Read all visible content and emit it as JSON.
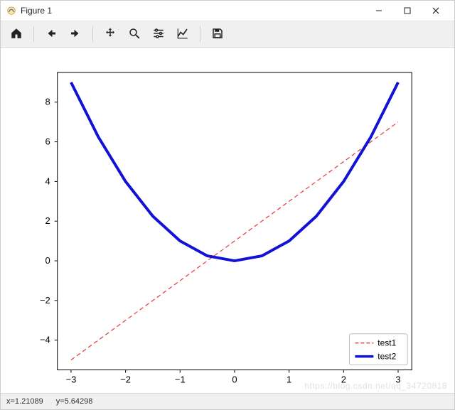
{
  "window": {
    "title": "Figure 1",
    "controls": {
      "minimize": "Minimize",
      "maximize": "Maximize",
      "close": "Close"
    }
  },
  "toolbar": {
    "home": "Home",
    "back": "Back",
    "forward": "Forward",
    "pan": "Pan",
    "zoom": "Zoom",
    "subplots": "Configure subplots",
    "axes": "Edit axis",
    "save": "Save"
  },
  "statusbar": {
    "x_label": "x=1.21089",
    "y_label": "y=5.64298"
  },
  "watermark": "https://blog.csdn.net/qq_34720818",
  "legend": {
    "item1": "test1",
    "item2": "test2"
  },
  "xticks": {
    "m3": "−3",
    "m2": "−2",
    "m1": "−1",
    "p0": "0",
    "p1": "1",
    "p2": "2",
    "p3": "3"
  },
  "yticks": {
    "m4": "−4",
    "m2": "−2",
    "p0": "0",
    "p2": "2",
    "p4": "4",
    "p6": "6",
    "p8": "8"
  },
  "chart_data": {
    "type": "line",
    "x": [
      -3,
      -2.5,
      -2,
      -1.5,
      -1,
      -0.5,
      0,
      0.5,
      1,
      1.5,
      2,
      2.5,
      3
    ],
    "series": [
      {
        "name": "test1",
        "style": "dashed",
        "color": "#E23B3B",
        "width": 1,
        "values": [
          -5,
          -4,
          -3,
          -2,
          -1,
          0,
          1,
          2,
          3,
          4,
          5,
          6,
          7
        ]
      },
      {
        "name": "test2",
        "style": "solid",
        "color": "#1212D6",
        "width": 3,
        "values": [
          9,
          6.25,
          4,
          2.25,
          1,
          0.25,
          0,
          0.25,
          1,
          2.25,
          4,
          6.25,
          9
        ]
      }
    ],
    "legend_position": "lower right",
    "xlabel": "",
    "ylabel": "",
    "xlim": [
      -3.25,
      3.25
    ],
    "ylim": [
      -5.5,
      9.5
    ],
    "xticks": [
      -3,
      -2,
      -1,
      0,
      1,
      2,
      3
    ],
    "yticks": [
      -4,
      -2,
      0,
      2,
      4,
      6,
      8
    ],
    "grid": false
  },
  "colors": {
    "line1": "#E23B3B",
    "line2": "#1212D6",
    "axes": "#000000",
    "toolbar_bg": "#F0F0F0"
  }
}
